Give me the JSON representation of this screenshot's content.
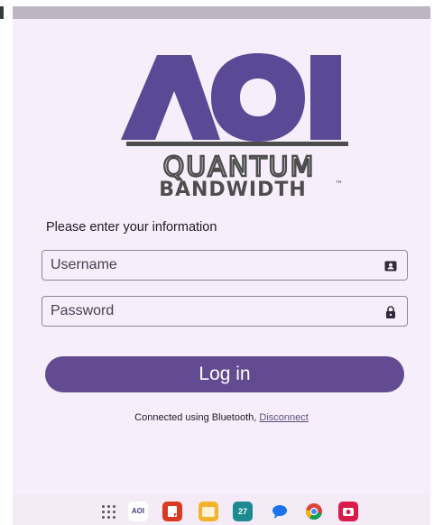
{
  "logo": {
    "letters": "AOI",
    "line1": "QUANTUM",
    "line2": "BANDWIDTH",
    "trademark": "™",
    "brand_color": "#5a4a96",
    "text_color": "#4d4d4d"
  },
  "form": {
    "prompt": "Please enter your information",
    "username_placeholder": "Username",
    "password_placeholder": "Password",
    "username_icon": "contact-card-icon",
    "password_icon": "lock-icon",
    "login_label": "Log in"
  },
  "connection": {
    "status_text": "Connected using Bluetooth,",
    "disconnect_label": "Disconnect"
  },
  "dock": {
    "apps": [
      "app-grid-icon",
      "aoi-app-icon",
      "keep-icon",
      "files-icon",
      "calendar-icon",
      "messages-icon",
      "chrome-icon",
      "camera-icon"
    ],
    "calendar_day": "27",
    "aoi_label": "AOI"
  },
  "colors": {
    "background": "#f7eefb",
    "button": "#624b91",
    "status_bar": "#bdb5c2"
  }
}
